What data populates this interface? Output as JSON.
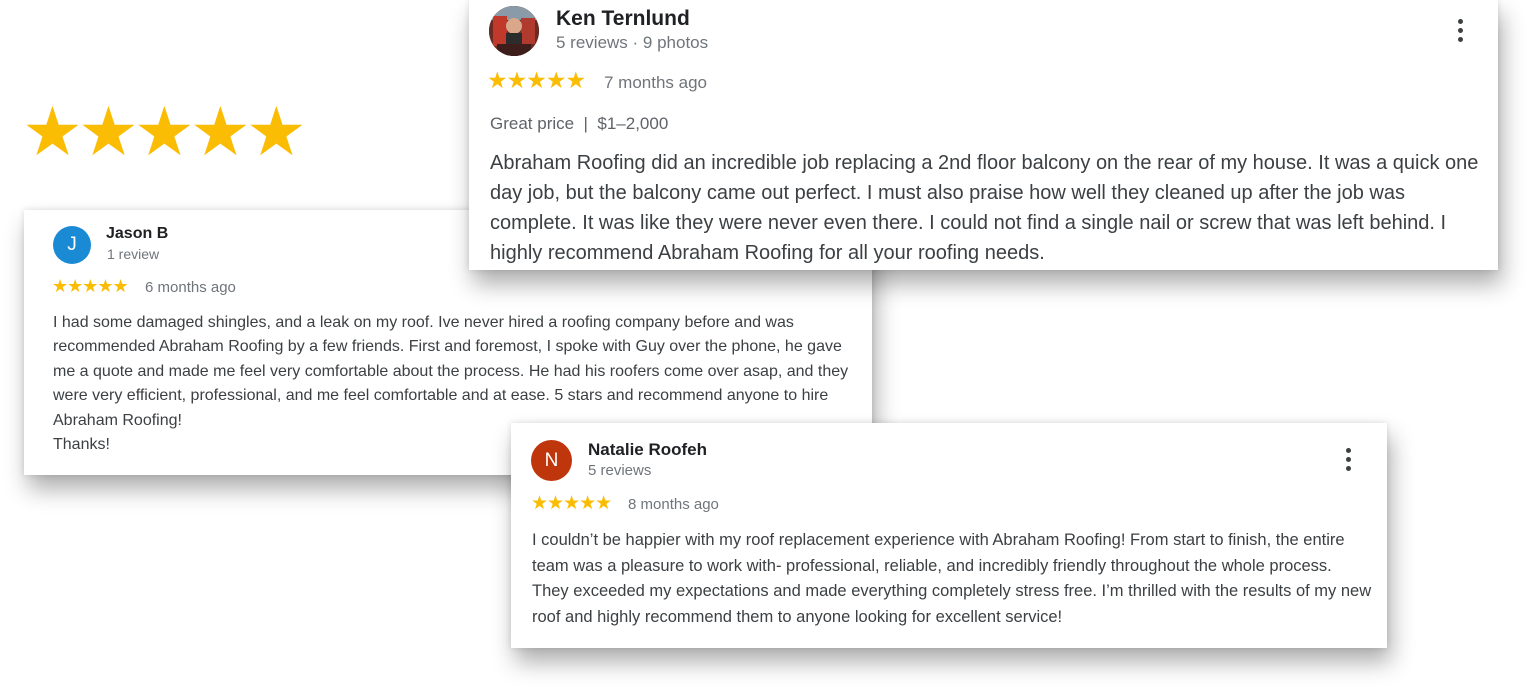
{
  "hero": {
    "stars": "★★★★★"
  },
  "reviews": {
    "ken": {
      "avatar_icon": "profile-photo",
      "name": "Ken Ternlund",
      "meta": "5 reviews · 9 photos",
      "stars": "★★★★★",
      "time_ago": "7 months ago",
      "price": "Great price  |  $1–2,000",
      "text": "Abraham Roofing did an incredible job replacing a 2nd floor balcony on the rear of my house. It was a quick one day job, but the balcony came out perfect. I must also praise how well they cleaned up after the job was complete. It was like they were never even there. I could not find a single nail or screw that was left behind. I highly recommend Abraham Roofing for all your roofing needs.",
      "menu_icon": "more-vertical-icon"
    },
    "jason": {
      "avatar_letter": "J",
      "avatar_color": "#1a8ad4",
      "name": "Jason B",
      "meta": "1 review",
      "stars": "★★★★★",
      "time_ago": "6 months ago",
      "text": "I had some damaged shingles, and a leak on my roof. Ive never hired a roofing company before and was recommended Abraham Roofing by a few friends. First and foremost, I spoke with Guy over the phone, he gave me a quote and made me feel very comfortable about the process. He had his roofers come over asap, and they were very efficient, professional, and me feel comfortable and at ease. 5 stars and recommend anyone to hire Abraham Roofing!\nThanks!"
    },
    "natalie": {
      "avatar_letter": "N",
      "avatar_color": "#bf360c",
      "name": "Natalie Roofeh",
      "meta": "5 reviews",
      "stars": "★★★★★",
      "time_ago": "8 months ago",
      "text": "I couldn’t be happier with my roof replacement experience with Abraham Roofing! From start to finish, the entire team was a pleasure to work with- professional, reliable, and incredibly friendly throughout the whole process. They exceeded my expectations and made everything completely stress free. I’m thrilled with the results of my new roof and highly recommend them to anyone looking for excellent service!",
      "menu_icon": "more-vertical-icon"
    }
  },
  "colors": {
    "star": "#fbbc04",
    "text": "#3c4043",
    "muted": "#70757a",
    "name": "#202124"
  }
}
